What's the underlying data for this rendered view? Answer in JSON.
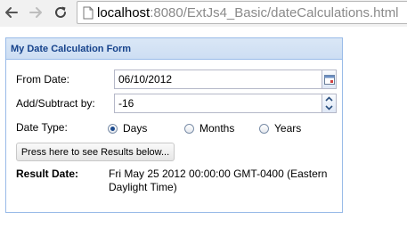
{
  "browser": {
    "url_host": "localhost",
    "url_rest": ":8080/ExtJs4_Basic/dateCalculations.html"
  },
  "form": {
    "title": "My Date Calculation Form",
    "from_date_label": "From Date:",
    "from_date_value": "06/10/2012",
    "add_subtract_label": "Add/Subtract by:",
    "add_subtract_value": "-16",
    "date_type_label": "Date Type:",
    "date_type_options": [
      "Days",
      "Months",
      "Years"
    ],
    "date_type_selected": "Days",
    "button_label": "Press here to see Results below...",
    "result_label": "Result Date:",
    "result_value": "Fri May 25 2012 00:00:00 GMT-0400 (Eastern Daylight Time)"
  },
  "icons": {
    "back": "arrow-left-icon",
    "forward": "arrow-right-icon",
    "reload": "reload-icon",
    "page": "page-icon",
    "calendar": "calendar-icon",
    "spinner": "spinner-arrows-icon"
  },
  "colors": {
    "panel_border": "#99bbe8",
    "panel_title": "#15428b",
    "header_bg": "#cddef3"
  }
}
